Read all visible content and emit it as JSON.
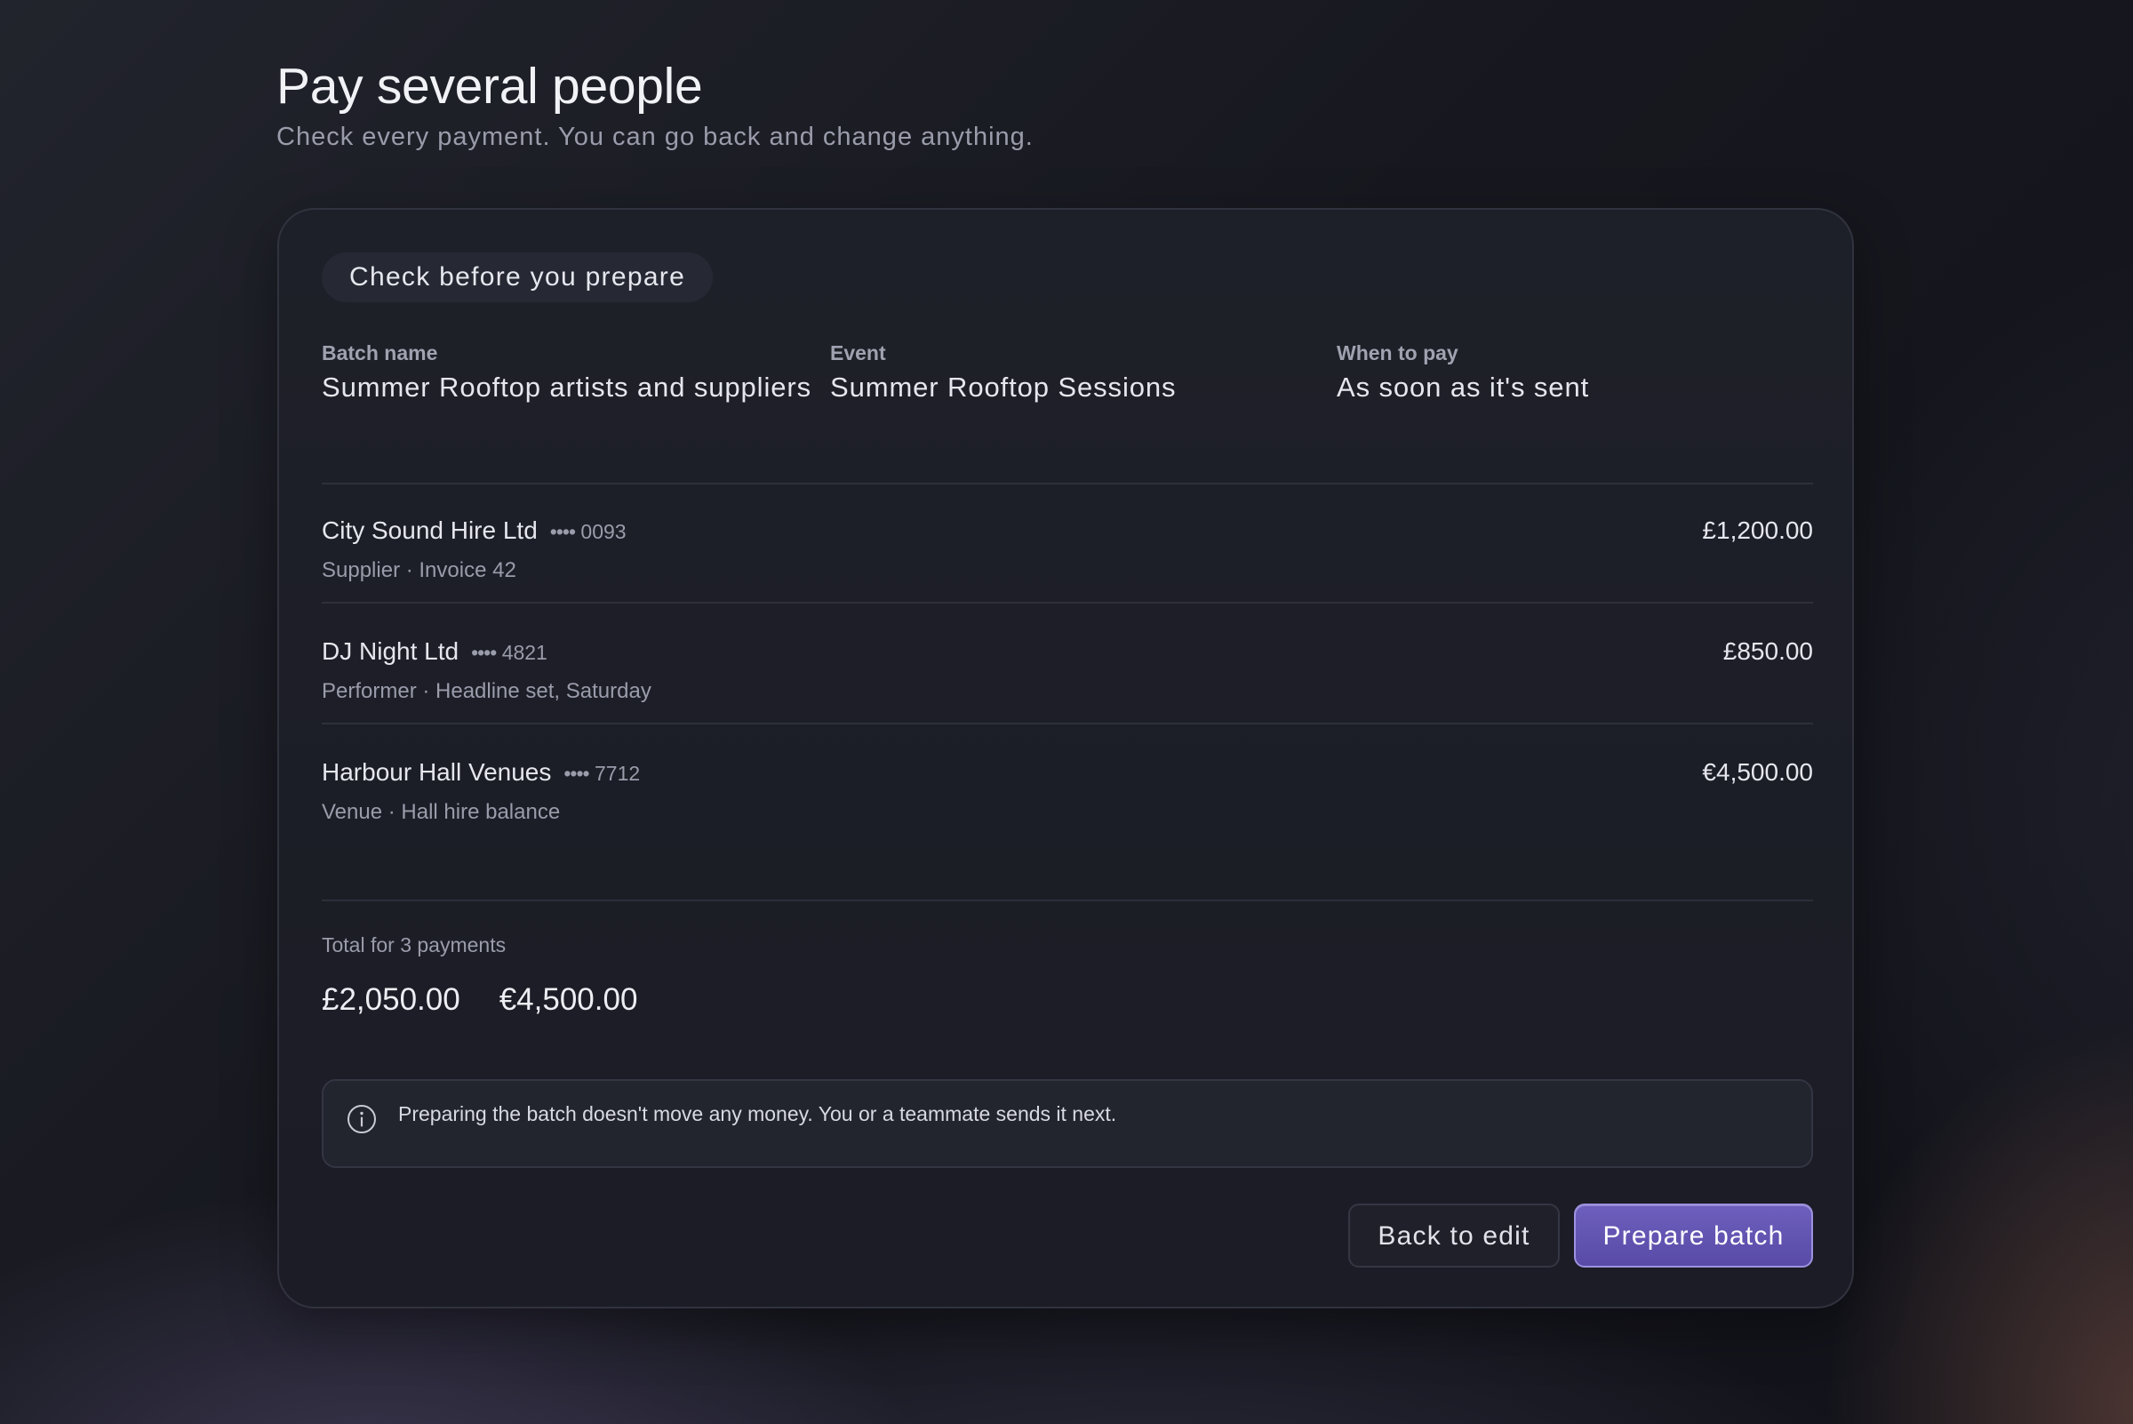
{
  "header": {
    "title": "Pay several people",
    "subtitle": "Check every payment. You can go back and change anything."
  },
  "review": {
    "pill_label": "Check before you prepare",
    "summary": [
      {
        "label": "Batch name",
        "value": "Summer Rooftop artists and suppliers"
      },
      {
        "label": "Event",
        "value": "Summer Rooftop Sessions"
      },
      {
        "label": "When to pay",
        "value": "As soon as it's sent"
      }
    ],
    "payments": [
      {
        "name": "City Sound Hire Ltd",
        "account_dots": "••••",
        "account_last4": "0093",
        "meta": "Supplier · Invoice 42",
        "amount": "£1,200.00"
      },
      {
        "name": "DJ Night Ltd",
        "account_dots": "••••",
        "account_last4": "4821",
        "meta": "Performer · Headline set, Saturday",
        "amount": "£850.00"
      },
      {
        "name": "Harbour Hall Venues",
        "account_dots": "••••",
        "account_last4": "7712",
        "meta": "Venue · Hall hire balance",
        "amount": "€4,500.00"
      }
    ],
    "total": {
      "label": "Total for 3 payments",
      "amounts": [
        "£2,050.00",
        "€4,500.00"
      ]
    },
    "notice": {
      "icon": "info-icon",
      "text": "Preparing the batch doesn't move any money. You or a teammate sends it next."
    },
    "actions": {
      "back_label": "Back to edit",
      "prepare_label": "Prepare batch"
    }
  },
  "colors": {
    "accent": "#6e5fbe",
    "background": "#17181f",
    "card": "#1e2029"
  }
}
